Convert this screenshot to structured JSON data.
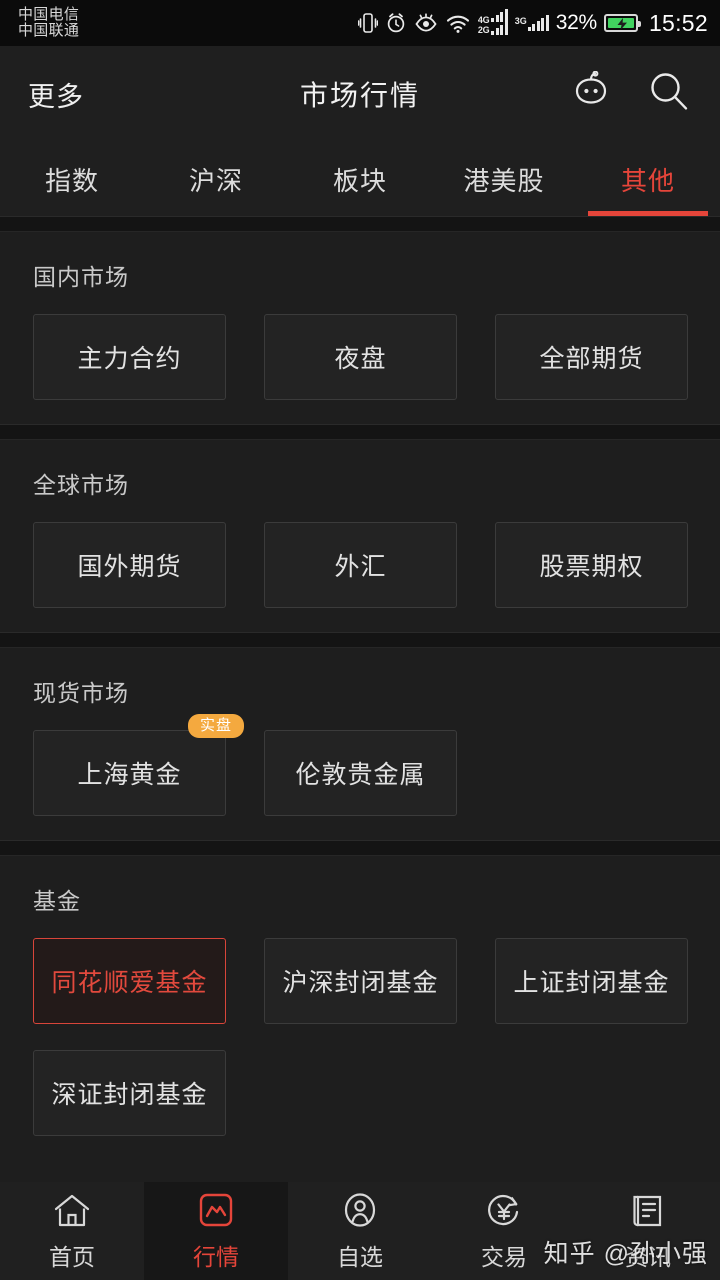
{
  "statusbar": {
    "carriers": [
      "中国电信",
      "中国联通"
    ],
    "icons": [
      "vibrate-icon",
      "alarm-icon",
      "eye-care-icon",
      "wifi-icon"
    ],
    "signal_primary_labels": [
      "4G",
      "2G"
    ],
    "signal_secondary_label": "3G",
    "battery_percent": "32%",
    "battery_charging": true,
    "time": "15:52"
  },
  "header": {
    "left_label": "更多",
    "title": "市场行情",
    "robot_icon": "robot-icon",
    "search_icon": "search-icon"
  },
  "tabs": {
    "items": [
      {
        "label": "指数",
        "active": false
      },
      {
        "label": "沪深",
        "active": false
      },
      {
        "label": "板块",
        "active": false
      },
      {
        "label": "港美股",
        "active": false
      },
      {
        "label": "其他",
        "active": true
      }
    ],
    "active_color": "#e5453a"
  },
  "sections": [
    {
      "title": "国内市场",
      "items": [
        {
          "label": "主力合约",
          "selected": false,
          "badge": null
        },
        {
          "label": "夜盘",
          "selected": false,
          "badge": null
        },
        {
          "label": "全部期货",
          "selected": false,
          "badge": null
        }
      ]
    },
    {
      "title": "全球市场",
      "items": [
        {
          "label": "国外期货",
          "selected": false,
          "badge": null
        },
        {
          "label": "外汇",
          "selected": false,
          "badge": null
        },
        {
          "label": "股票期权",
          "selected": false,
          "badge": null
        }
      ]
    },
    {
      "title": "现货市场",
      "items": [
        {
          "label": "上海黄金",
          "selected": false,
          "badge": "实盘"
        },
        {
          "label": "伦敦贵金属",
          "selected": false,
          "badge": null
        }
      ]
    },
    {
      "title": "基金",
      "items": [
        {
          "label": "同花顺爱基金",
          "selected": true,
          "badge": null
        },
        {
          "label": "沪深封闭基金",
          "selected": false,
          "badge": null
        },
        {
          "label": "上证封闭基金",
          "selected": false,
          "badge": null
        },
        {
          "label": "深证封闭基金",
          "selected": false,
          "badge": null
        }
      ]
    }
  ],
  "bottom_nav": {
    "items": [
      {
        "label": "首页",
        "icon": "home-icon",
        "active": false
      },
      {
        "label": "行情",
        "icon": "chart-square-icon",
        "active": true
      },
      {
        "label": "自选",
        "icon": "person-circle-icon",
        "active": false
      },
      {
        "label": "交易",
        "icon": "yuan-refresh-icon",
        "active": false
      },
      {
        "label": "资讯",
        "icon": "news-icon",
        "active": false
      }
    ]
  },
  "watermark": "知乎 @孙小强",
  "colors": {
    "background": "#1e1e1e",
    "accent_red": "#e5453a",
    "badge_orange": "#f4a93f",
    "battery_green": "#41d360"
  }
}
